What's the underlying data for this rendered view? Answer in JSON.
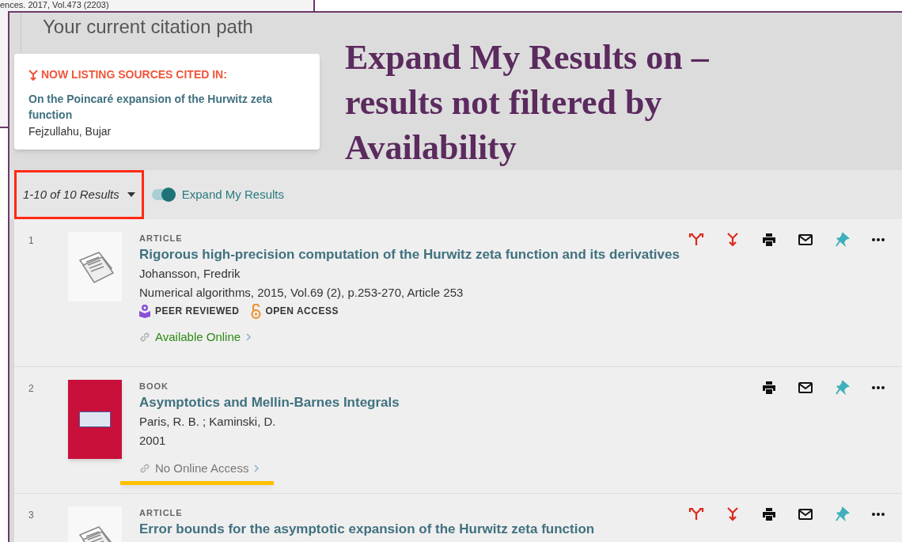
{
  "background_text": "ences. 2017, Vol.473 (2203)",
  "citation_path": {
    "title": "Your current citation path",
    "label": "NOW LISTING SOURCES CITED IN:",
    "source_title": "On the Poincaré expansion of the Hurwitz zeta function",
    "source_author": "Fejzullahu, Bujar"
  },
  "annotation": "Expand My Results on – results not filtered by Availability",
  "toolbar": {
    "results_count": "1-10 of 10 Results",
    "expand_toggle": {
      "label": "Expand My Results",
      "on": true
    }
  },
  "results": [
    {
      "number": "1",
      "thumbnail": {
        "kind": "generic"
      },
      "type": "ARTICLE",
      "title": "Rigorous high-precision computation of the Hurwitz zeta function and its derivatives",
      "lines": [
        "Johansson, Fredrik",
        "Numerical algorithms, 2015, Vol.69 (2), p.253-270, Article 253"
      ],
      "badges": [
        {
          "kind": "peer",
          "label": "PEER REVIEWED"
        },
        {
          "kind": "open",
          "label": "OPEN ACCESS"
        }
      ],
      "availability": {
        "kind": "online",
        "label": "Available Online",
        "underlined": false
      },
      "actions": [
        {
          "kind": "citing"
        },
        {
          "kind": "cited"
        },
        {
          "kind": "print"
        },
        {
          "kind": "email"
        },
        {
          "kind": "pin"
        },
        {
          "kind": "more"
        }
      ]
    },
    {
      "number": "2",
      "thumbnail": {
        "kind": "cover"
      },
      "type": "BOOK",
      "title": "Asymptotics and Mellin-Barnes Integrals",
      "lines": [
        "Paris, R. B. ; Kaminski, D.",
        "2001"
      ],
      "availability": {
        "kind": "none",
        "label": "No Online Access",
        "underlined": true
      },
      "actions": [
        {
          "kind": "print"
        },
        {
          "kind": "email"
        },
        {
          "kind": "pin"
        },
        {
          "kind": "more"
        }
      ]
    },
    {
      "number": "3",
      "thumbnail": {
        "kind": "generic"
      },
      "type": "ARTICLE",
      "title": "Error bounds for the asymptotic expansion of the Hurwitz zeta function",
      "actions": [
        {
          "kind": "citing"
        },
        {
          "kind": "cited"
        },
        {
          "kind": "print"
        },
        {
          "kind": "email"
        },
        {
          "kind": "pin"
        },
        {
          "kind": "more"
        }
      ]
    }
  ]
}
